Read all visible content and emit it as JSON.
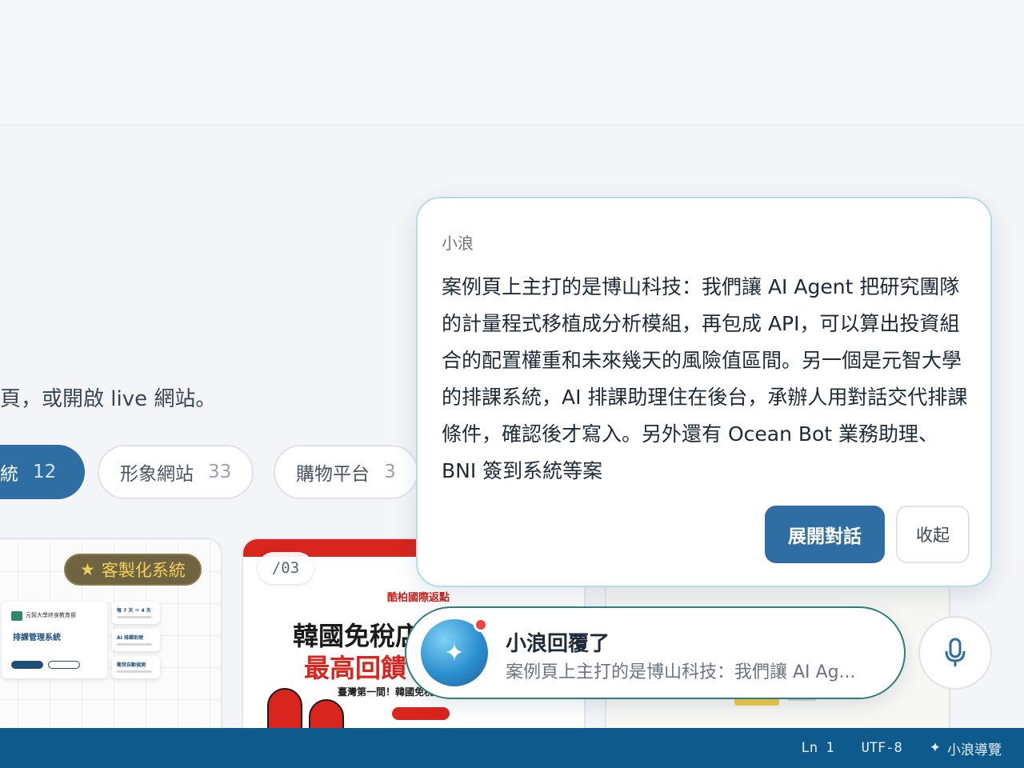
{
  "intro_text": "頁，或開啟 live 網站。",
  "filters": [
    {
      "label": "統",
      "count": "12"
    },
    {
      "label": "形象網站",
      "count": "33"
    },
    {
      "label": "購物平台",
      "count": "3"
    }
  ],
  "cards": {
    "card1": {
      "badge": "客製化系統",
      "org": "元智大學終身教育部",
      "system_title": "排課管理系統",
      "feature_a": "每 7 天 ＝ 4 天",
      "feature_b": "AI 排課助理",
      "feature_c": "衝突自動偵測"
    },
    "card2": {
      "page_num": "/03",
      "subtitle": "酷柏國際返點",
      "heading1": "韓國免稅店",
      "heading2": "最高回饋",
      "tagline": "臺灣第一間！韓國免稅"
    }
  },
  "chat": {
    "author": "小浪",
    "message": "案例頁上主打的是博山科技：我們讓 AI Agent 把研究團隊的計量程式移植成分析模組，再包成 API，可以算出投資組合的配置權重和未來幾天的風險值區間。另一個是元智大學的排課系統，AI 排課助理住在後台，承辦人用對話交代排課條件，確認後才寫入。另外還有 Ocean Bot 業務助理、BNI 簽到系統等案",
    "expand_label": "展開對話",
    "collapse_label": "收起"
  },
  "toast": {
    "title": "小浪回覆了",
    "preview": "案例頁上主打的是博山科技：我們讓 AI Ag..."
  },
  "statusbar": {
    "line": "Ln 1",
    "encoding": "UTF-8",
    "assistant": "小浪導覽"
  },
  "colors": {
    "accent": "#2f6ea3",
    "statusbar": "#0f5a8c",
    "toast_border": "#2f7d78",
    "notify_dot": "#ef4444"
  },
  "icons": {
    "badge": "star-icon",
    "orb": "sparkle-icon",
    "mic": "microphone-icon",
    "status": "sparkle-icon"
  }
}
